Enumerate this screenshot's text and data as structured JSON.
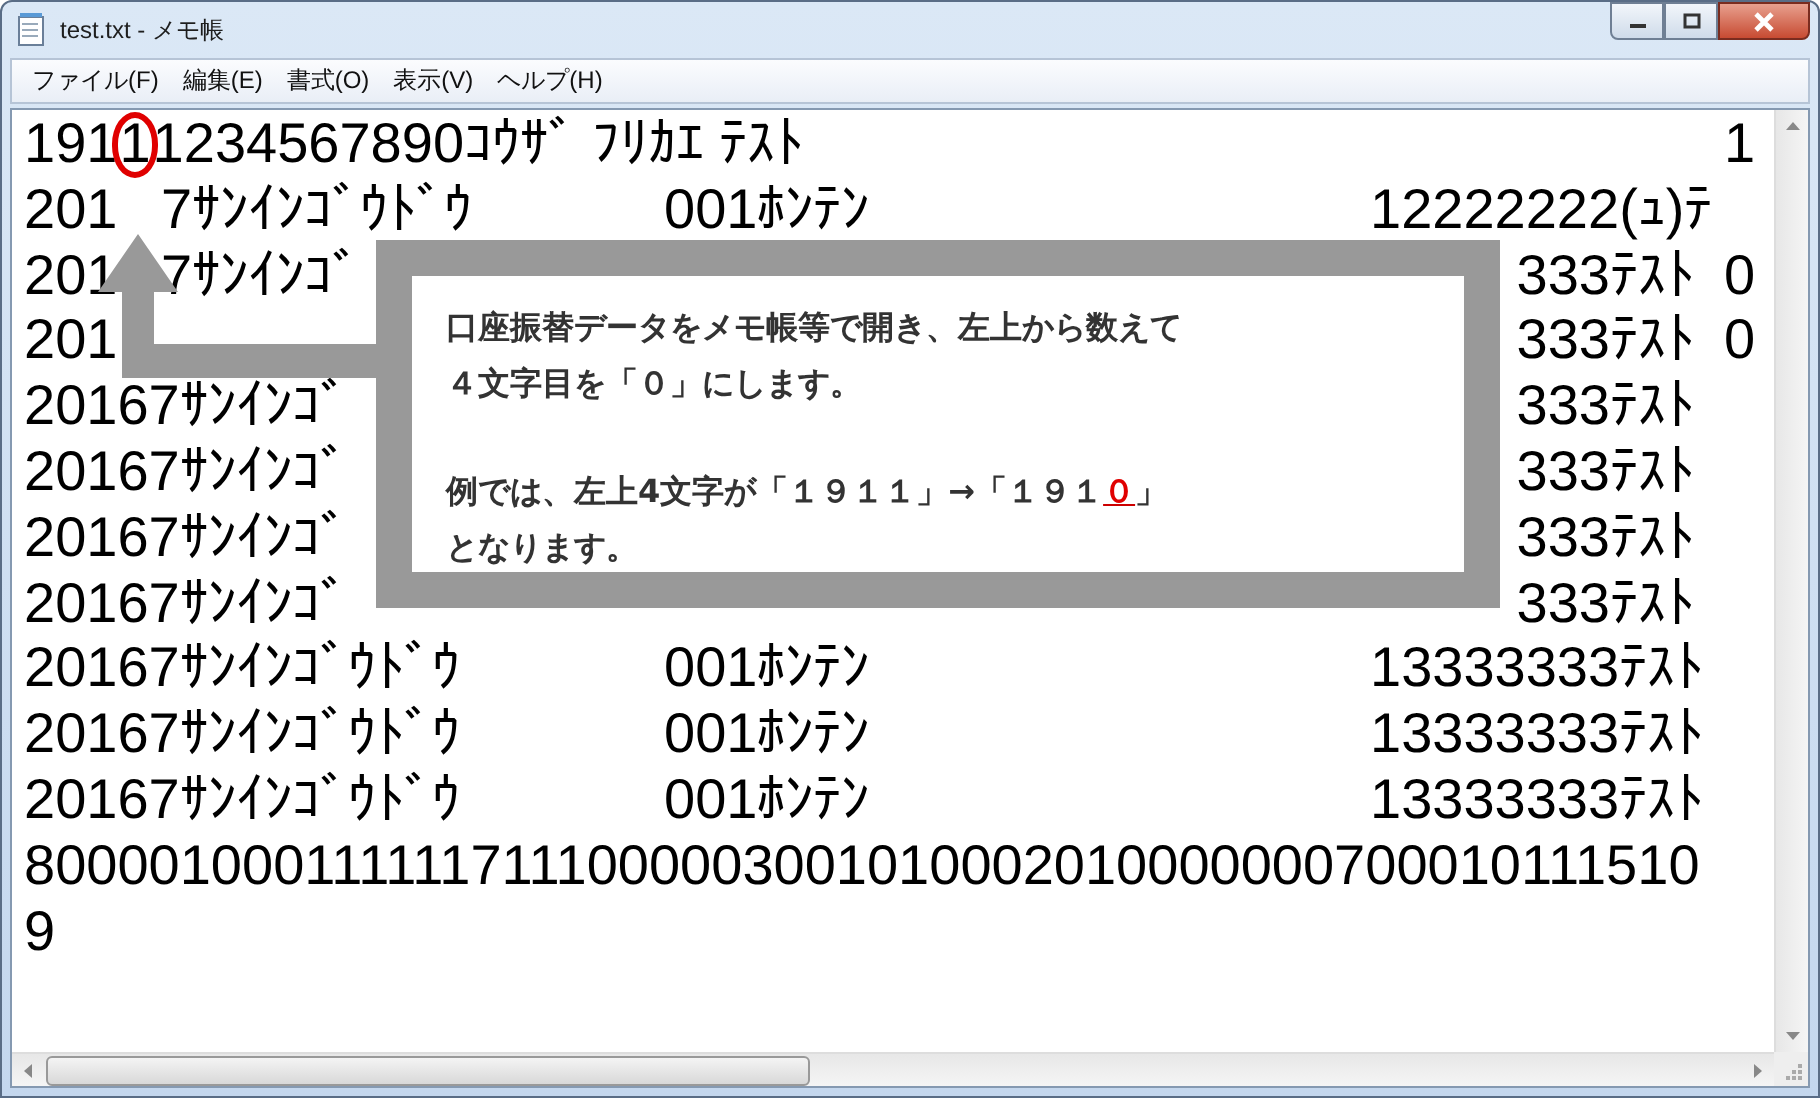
{
  "window": {
    "title": "test.txt - メモ帳"
  },
  "menu": [
    {
      "label": "ファイル(F)"
    },
    {
      "label": "編集(E)"
    },
    {
      "label": "書式(O)"
    },
    {
      "label": "表示(V)"
    },
    {
      "label": "ヘルプ(H)"
    }
  ],
  "editor": {
    "rows": [
      {
        "column_1": [
          {
            "kind": "text",
            "text": "191"
          },
          {
            "kind": "circled",
            "text": "1"
          },
          {
            "kind": "text",
            "text": "1234567890ｺｳｻﾞ ﾌﾘｶｴ ﾃｽﾄ"
          }
        ],
        "column_4": "1"
      },
      {
        "column_1": [
          {
            "kind": "text",
            "text": "201"
          },
          {
            "kind": "gap"
          },
          {
            "kind": "text",
            "text": "7ｻﾝｲﾝｺﾞｳﾄﾞｳ"
          }
        ],
        "column_2": "001ﾎﾝﾃﾝ",
        "column_3": "12222222(ｭ)ﾃ"
      },
      {
        "column_1": [
          {
            "kind": "text",
            "text": "201"
          },
          {
            "kind": "gap"
          },
          {
            "kind": "text",
            "text": "7ｻﾝｲﾝｺﾞ"
          }
        ],
        "column_3_end": "333ﾃｽﾄ",
        "column_4": "0"
      },
      {
        "column_1": [
          {
            "kind": "text",
            "text": "201"
          }
        ],
        "column_3_end": "333ﾃｽﾄ",
        "column_4": "0"
      },
      {
        "column_1": [
          {
            "kind": "text",
            "text": "20167ｻﾝｲﾝｺﾞ"
          }
        ],
        "column_3_end": "333ﾃｽﾄ"
      },
      {
        "column_1": [
          {
            "kind": "text",
            "text": "20167ｻﾝｲﾝｺﾞ"
          }
        ],
        "column_3_end": "333ﾃｽﾄ"
      },
      {
        "column_1": [
          {
            "kind": "text",
            "text": "20167ｻﾝｲﾝｺﾞ"
          }
        ],
        "column_3_end": "333ﾃｽﾄ"
      },
      {
        "column_1": [
          {
            "kind": "text",
            "text": "20167ｻﾝｲﾝｺﾞ"
          }
        ],
        "column_3_end": "333ﾃｽﾄ"
      },
      {
        "column_1": [
          {
            "kind": "text",
            "text": "20167ｻﾝｲﾝｺﾞｳﾄﾞｳ"
          }
        ],
        "column_2": "001ﾎﾝﾃﾝ",
        "column_3": "13333333ﾃｽﾄ"
      },
      {
        "column_1": [
          {
            "kind": "text",
            "text": "20167ｻﾝｲﾝｺﾞｳﾄﾞｳ"
          }
        ],
        "column_2": "001ﾎﾝﾃﾝ",
        "column_3": "13333333ﾃｽﾄ"
      },
      {
        "column_1": [
          {
            "kind": "text",
            "text": "20167ｻﾝｲﾝｺﾞｳﾄﾞｳ"
          }
        ],
        "column_2": "001ﾎﾝﾃﾝ",
        "column_3": "13333333ﾃｽﾄ"
      },
      {
        "column_1": [
          {
            "kind": "text",
            "text": "8000010001111117111000003001010002010000000700010111510"
          }
        ]
      },
      {
        "column_1": [
          {
            "kind": "text",
            "text": "9"
          }
        ]
      }
    ]
  },
  "callout": {
    "paragraphs": [
      {
        "lines": [
          [
            {
              "kind": "plain",
              "text": "口座振替データをメモ帳等で開き、左上から数えて"
            }
          ],
          [
            {
              "kind": "plain",
              "text": "４文字目を「０」にします。"
            }
          ]
        ]
      },
      {
        "lines": [
          [
            {
              "kind": "plain",
              "text": "例では、左上4文字が「１９１１」→「１９１"
            },
            {
              "kind": "emphasis",
              "text": "０"
            },
            {
              "kind": "plain",
              "text": "」"
            }
          ],
          [
            {
              "kind": "plain",
              "text": "となります。"
            }
          ]
        ]
      }
    ]
  }
}
